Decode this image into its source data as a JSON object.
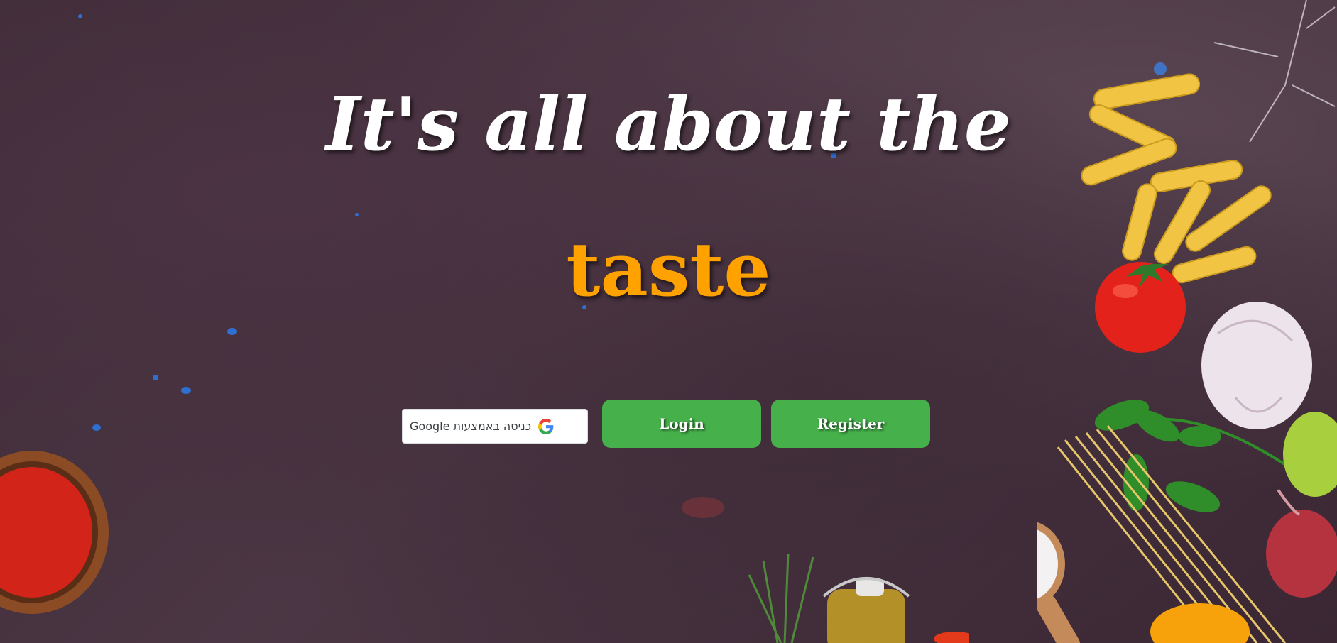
{
  "hero": {
    "line1": "It's all about the",
    "line2": "taste"
  },
  "auth": {
    "google_label": "כניסה באמצעות Google",
    "google_icon": "google-g-icon",
    "login_label": "Login",
    "register_label": "Register"
  },
  "colors": {
    "accent": "#ffa200",
    "button": "#46b04b",
    "background": "#3e2a37"
  }
}
